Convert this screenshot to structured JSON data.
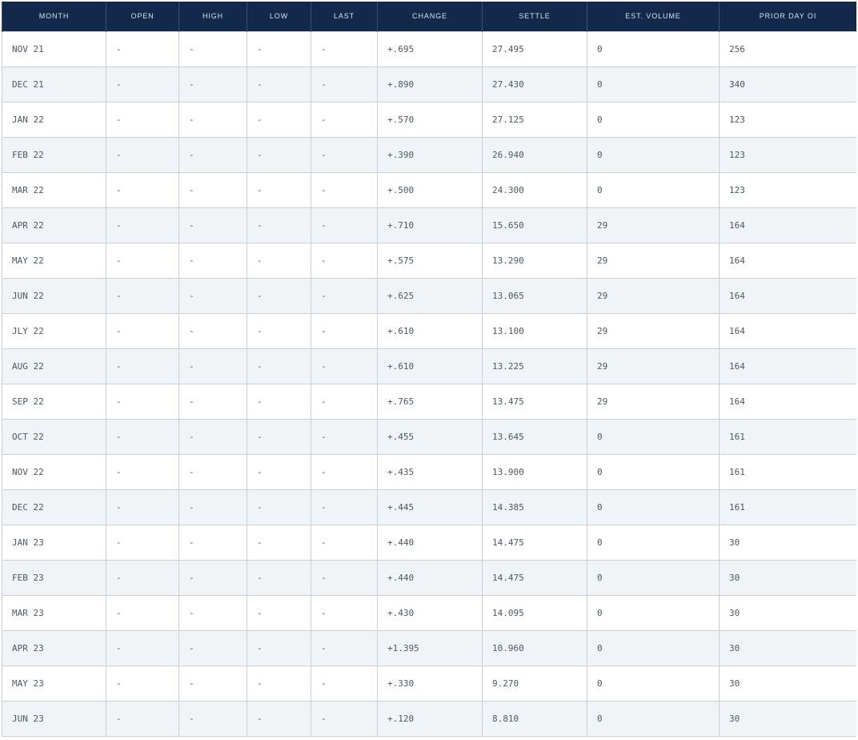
{
  "columns": [
    "MONTH",
    "OPEN",
    "HIGH",
    "LOW",
    "LAST",
    "CHANGE",
    "SETTLE",
    "EST. VOLUME",
    "PRIOR DAY OI"
  ],
  "rows": [
    [
      "NOV 21",
      "-",
      "-",
      "-",
      "-",
      "+.695",
      "27.495",
      "0",
      "256"
    ],
    [
      "DEC 21",
      "-",
      "-",
      "-",
      "-",
      "+.890",
      "27.430",
      "0",
      "340"
    ],
    [
      "JAN 22",
      "-",
      "-",
      "-",
      "-",
      "+.570",
      "27.125",
      "0",
      "123"
    ],
    [
      "FEB 22",
      "-",
      "-",
      "-",
      "-",
      "+.390",
      "26.940",
      "0",
      "123"
    ],
    [
      "MAR 22",
      "-",
      "-",
      "-",
      "-",
      "+.500",
      "24.300",
      "0",
      "123"
    ],
    [
      "APR 22",
      "-",
      "-",
      "-",
      "-",
      "+.710",
      "15.650",
      "29",
      "164"
    ],
    [
      "MAY 22",
      "-",
      "-",
      "-",
      "-",
      "+.575",
      "13.290",
      "29",
      "164"
    ],
    [
      "JUN 22",
      "-",
      "-",
      "-",
      "-",
      "+.625",
      "13.065",
      "29",
      "164"
    ],
    [
      "JLY 22",
      "-",
      "-",
      "-",
      "-",
      "+.610",
      "13.100",
      "29",
      "164"
    ],
    [
      "AUG 22",
      "-",
      "-",
      "-",
      "-",
      "+.610",
      "13.225",
      "29",
      "164"
    ],
    [
      "SEP 22",
      "-",
      "-",
      "-",
      "-",
      "+.765",
      "13.475",
      "29",
      "164"
    ],
    [
      "OCT 22",
      "-",
      "-",
      "-",
      "-",
      "+.455",
      "13.645",
      "0",
      "161"
    ],
    [
      "NOV 22",
      "-",
      "-",
      "-",
      "-",
      "+.435",
      "13.900",
      "0",
      "161"
    ],
    [
      "DEC 22",
      "-",
      "-",
      "-",
      "-",
      "+.445",
      "14.385",
      "0",
      "161"
    ],
    [
      "JAN 23",
      "-",
      "-",
      "-",
      "-",
      "+.440",
      "14.475",
      "0",
      "30"
    ],
    [
      "FEB 23",
      "-",
      "-",
      "-",
      "-",
      "+.440",
      "14.475",
      "0",
      "30"
    ],
    [
      "MAR 23",
      "-",
      "-",
      "-",
      "-",
      "+.430",
      "14.095",
      "0",
      "30"
    ],
    [
      "APR 23",
      "-",
      "-",
      "-",
      "-",
      "+1.395",
      "10.960",
      "0",
      "30"
    ],
    [
      "MAY 23",
      "-",
      "-",
      "-",
      "-",
      "+.330",
      "9.270",
      "0",
      "30"
    ],
    [
      "JUN 23",
      "-",
      "-",
      "-",
      "-",
      "+.120",
      "8.810",
      "0",
      "30"
    ]
  ],
  "colors": {
    "header_bg": "#13294b",
    "header_text": "#d9e1ec",
    "row_alt_bg": "#f1f4f7",
    "cell_text": "#4a5868",
    "border": "#c9d0d8"
  }
}
